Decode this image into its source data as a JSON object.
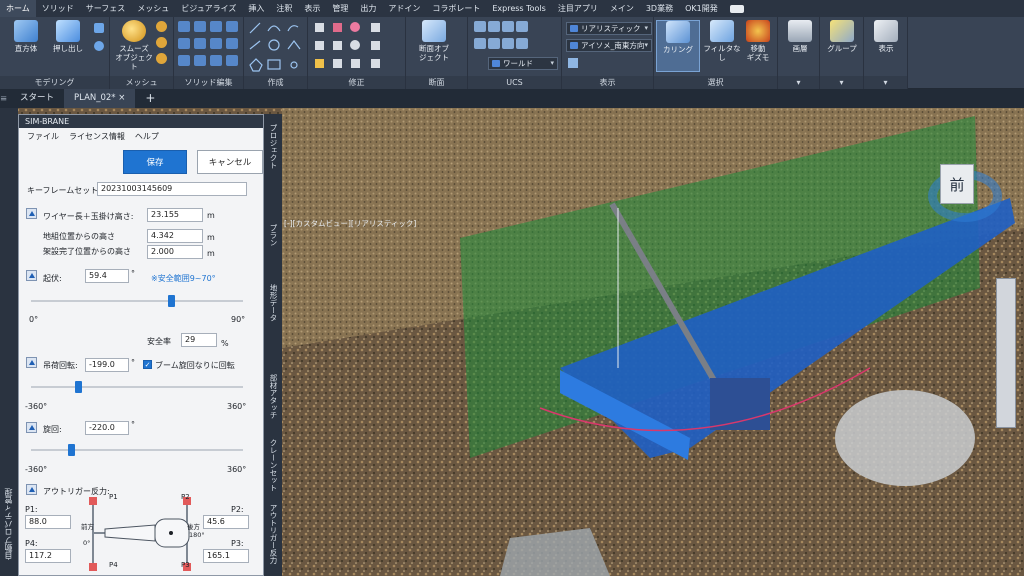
{
  "ribbon": {
    "tabs": [
      "ホーム",
      "ソリッド",
      "サーフェス",
      "メッシュ",
      "ビジュアライズ",
      "挿入",
      "注釈",
      "表示",
      "管理",
      "出力",
      "アドイン",
      "コラボレート",
      "Express Tools",
      "注目アプリ",
      "メイン",
      "3D業務",
      "OK1開発"
    ],
    "panels": {
      "modeling": {
        "label": "モデリング",
        "box": "直方体",
        "extrude": "押し出し"
      },
      "mesh": {
        "label": "メッシュ",
        "smooth": "スムーズ\nオブジェクト"
      },
      "solid_edit": {
        "label": "ソリッド編集"
      },
      "draw": {
        "label": "作成"
      },
      "modify": {
        "label": "修正"
      },
      "section": {
        "label": "断面",
        "section_plane": "断面オブ\nジェクト"
      },
      "ucs": {
        "label": "UCS",
        "world": "ワールド"
      },
      "view": {
        "label": "表示",
        "visual_style": "リアリスティック",
        "view_dir": "アイソメ_南東方向"
      },
      "selection": {
        "label": "選択",
        "culling": "カリング",
        "no_filter": "フィルタなし",
        "gizmo": "移動\nギズモ"
      },
      "layers": {
        "label": "画層"
      },
      "groups": {
        "label": "グループ"
      },
      "viewpanel": {
        "label": "表示"
      }
    }
  },
  "doc_tabs": {
    "start": "スタート",
    "plan": "PLAN_02*",
    "close": "×",
    "add": "+"
  },
  "sim": {
    "title": "SIM-BRANE",
    "menu": [
      "ファイル",
      "ライセンス情報",
      "ヘルプ"
    ],
    "save": "保存",
    "cancel": "キャンセル",
    "keyframe_label": "キーフレームセット名:",
    "keyframe_value": "20231003145609",
    "wire_label": "ワイヤー長＋玉掛け高さ:",
    "wire_value": "23.155",
    "unit_m": "m",
    "lift_label": "地組位置からの高さ",
    "lift_value": "4.342",
    "set_label": "架設完了位置からの高さ",
    "set_value": "2.000",
    "boom_label": "起伏:",
    "boom_value": "59.4",
    "deg": "°",
    "boom_note": "※安全範囲9~70°",
    "boom_min": "0°",
    "boom_max": "90°",
    "boom_level": 0.66,
    "safety_label": "安全率",
    "safety_value": "29",
    "percent": "%",
    "hook_label": "吊荷回転:",
    "hook_value": "-199.0",
    "follow_label": "ブーム旋回なりに回転",
    "hook_min": "-360°",
    "hook_max": "360°",
    "hook_level": 0.22,
    "swing_label": "旋回:",
    "swing_value": "-220.0",
    "swing_min": "-360°",
    "swing_max": "360°",
    "swing_level": 0.19,
    "outrigger_label": "アウトリガー反力:",
    "p1": "P1:",
    "p1_value": "88.0",
    "p2": "P2:",
    "p2_value": "45.6",
    "p3": "P3:",
    "p3_value": "165.1",
    "p4": "P4:",
    "p4_value": "117.2",
    "p1_tag": "P1",
    "p2_tag": "P2",
    "p3_tag": "P3",
    "p4_tag": "P4",
    "front": "前方",
    "rear": "後方",
    "ang0": "0°",
    "ang180": "180°"
  },
  "left_sidebar": "自動プロパティ管理",
  "side_tabs": [
    "プロジェクト",
    "プラン",
    "地形データ",
    "部材アタッチ",
    "クレーンセット",
    "アウトリガー反力"
  ],
  "viewport_title": "[-][カスタムビュー][リアリスティック]",
  "viewcube_face": "前"
}
